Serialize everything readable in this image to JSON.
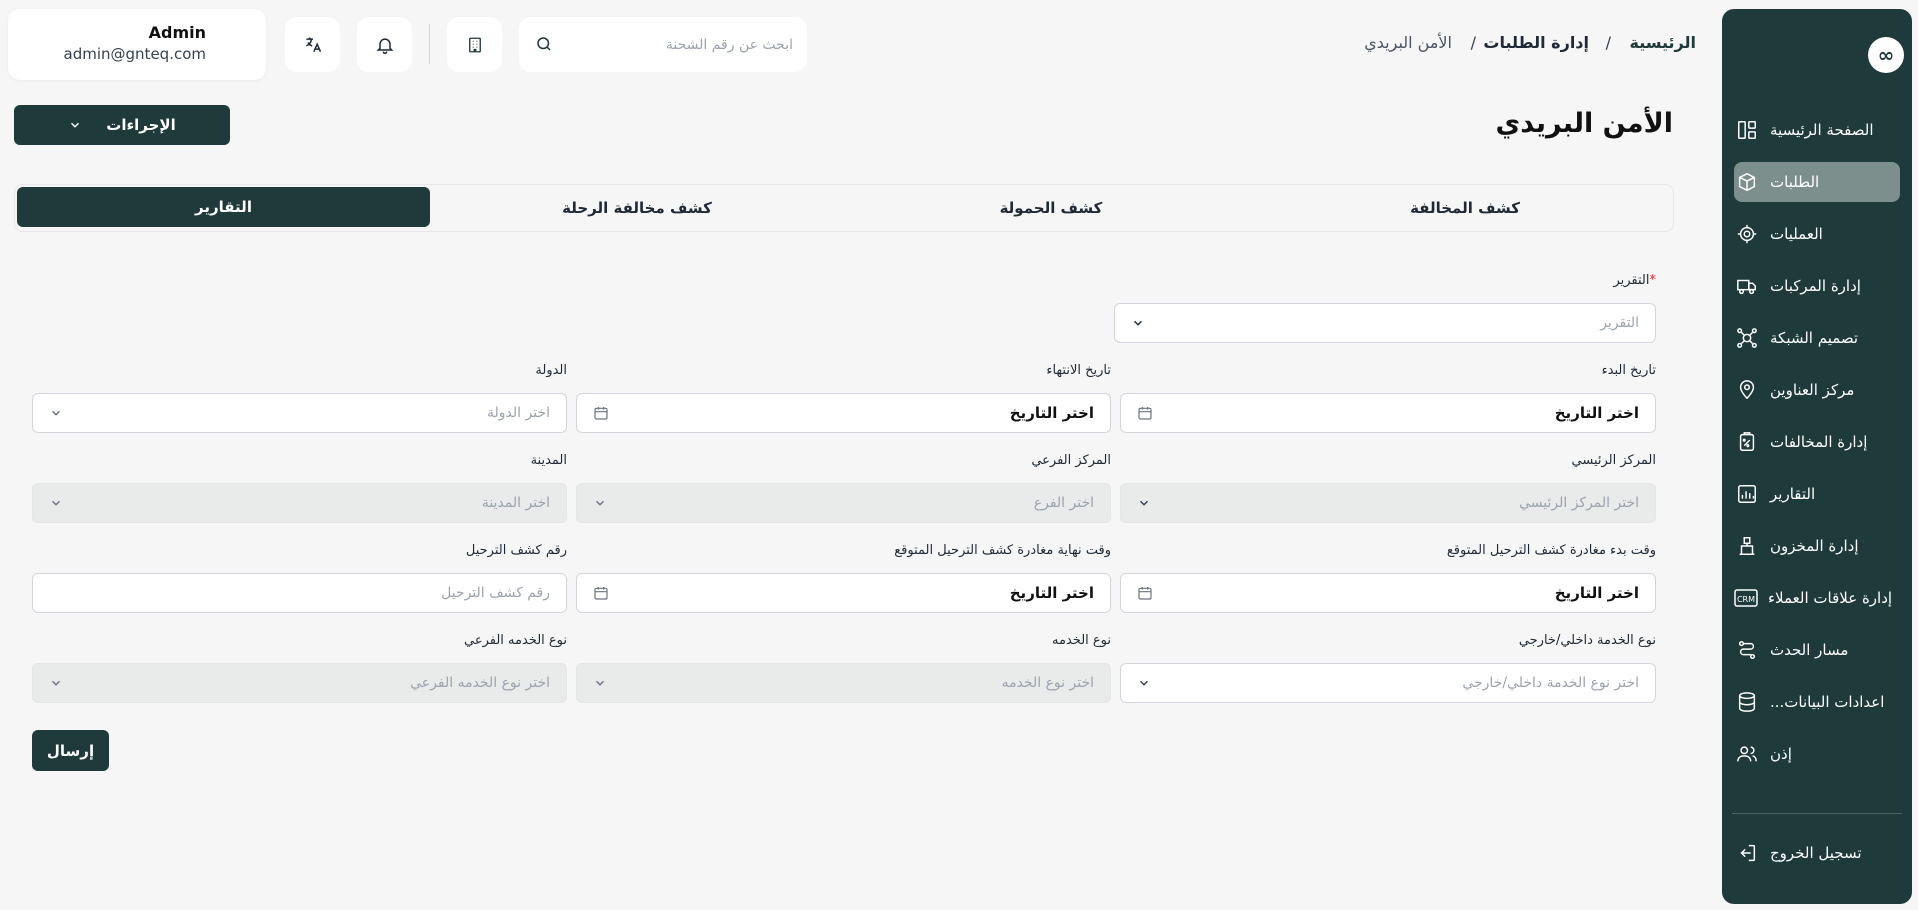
{
  "user": {
    "name": "Admin",
    "email": "admin@gnteq.com"
  },
  "search": {
    "placeholder": "ابحث عن رقم الشحنة"
  },
  "breadcrumb": {
    "home": "الرئيسية",
    "sep1": "/",
    "section": "إدارة الطلبات",
    "sep2": "/",
    "current": "الأمن البريدي"
  },
  "page": {
    "title": "الأمن البريدي",
    "actions_label": "الإجراءات",
    "submit_label": "إرسال"
  },
  "tabs": [
    {
      "label": "كشف المخالفة"
    },
    {
      "label": "كشف الحمولة"
    },
    {
      "label": "كشف مخالفة الرحلة"
    },
    {
      "label": "التقارير"
    }
  ],
  "sidebar": {
    "items": [
      {
        "label": "الصفحة الرئيسية",
        "icon": "dashboard-icon"
      },
      {
        "label": "الطلبات",
        "icon": "box-icon"
      },
      {
        "label": "العمليات",
        "icon": "settings-icon"
      },
      {
        "label": "إدارة المركبات",
        "icon": "truck-icon"
      },
      {
        "label": "تصميم الشبكة",
        "icon": "network-icon"
      },
      {
        "label": "مركز العناوين",
        "icon": "location-icon"
      },
      {
        "label": "إدارة المخالفات",
        "icon": "violation-icon"
      },
      {
        "label": "التقارير",
        "icon": "report-icon"
      },
      {
        "label": "إدارة المخزون",
        "icon": "inventory-icon"
      },
      {
        "label": "إدارة علاقات العملاء",
        "icon": "crm-icon"
      },
      {
        "label": "مسار الحدث",
        "icon": "route-icon"
      },
      {
        "label": "اعدادات البيانات...",
        "icon": "database-icon"
      },
      {
        "label": "إذن",
        "icon": "users-icon"
      }
    ],
    "logout": "تسجيل الخروج"
  },
  "form": {
    "report": {
      "label": "التقرير",
      "required": "*",
      "placeholder": "التقرير"
    },
    "start_date": {
      "label": "تاريخ البدء",
      "value": "اختر التاريخ"
    },
    "end_date": {
      "label": "تاريخ الانتهاء",
      "value": "اختر التاريخ"
    },
    "country": {
      "label": "الدولة",
      "placeholder": "اختر الدولة"
    },
    "main_center": {
      "label": "المركز الرئيسي",
      "placeholder": "اختر المركز الرئيسي"
    },
    "branch_center": {
      "label": "المركز الفرعي",
      "placeholder": "اختر الفرع"
    },
    "city": {
      "label": "المدينة",
      "placeholder": "اختر المدينة"
    },
    "dep_start": {
      "label": "وقت بدء مغادرة كشف الترحيل المتوقع",
      "value": "اختر التاريخ"
    },
    "dep_end": {
      "label": "وقت نهاية مغادرة كشف الترحيل المتوقع",
      "value": "اختر التاريخ"
    },
    "manifest_no": {
      "label": "رقم كشف الترحيل",
      "placeholder": "رقم كشف الترحيل"
    },
    "service_scope": {
      "label": "نوع الخدمة داخلي/خارجي",
      "placeholder": "اختر نوع الخدمة داخلي/خارجي"
    },
    "service_type": {
      "label": "نوع الخدمه",
      "placeholder": "اختر نوع الخدمه"
    },
    "service_subtype": {
      "label": "نوع الخدمه الفرعي",
      "placeholder": "اختر نوع الخدمه الفرعي"
    }
  }
}
